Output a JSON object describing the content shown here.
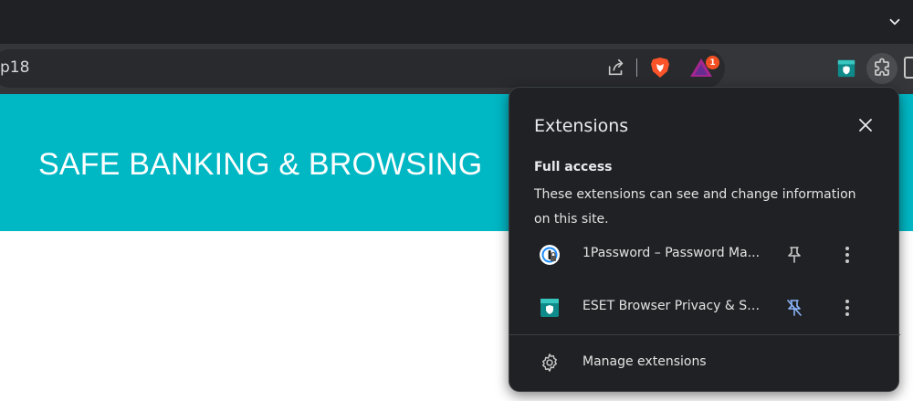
{
  "browser": {
    "address_text": "p18",
    "notification_count": "1"
  },
  "page": {
    "banner_title": "SAFE BANKING & BROWSING",
    "partial_text": "..........................."
  },
  "extensions_popup": {
    "title": "Extensions",
    "section_heading": "Full access",
    "section_description": "These extensions can see and change information on this site.",
    "extensions": [
      {
        "name": "1Password – Password Ma...",
        "icon": "onepassword-icon",
        "pinned": true
      },
      {
        "name": "ESET Browser Privacy & Se...",
        "icon": "eset-icon",
        "pinned": false
      }
    ],
    "manage_label": "Manage extensions"
  },
  "colors": {
    "banner": "#00b7c4",
    "popup_bg": "#202124",
    "toolbar_bg": "#353639",
    "pin_active": "#8ab4f8"
  }
}
